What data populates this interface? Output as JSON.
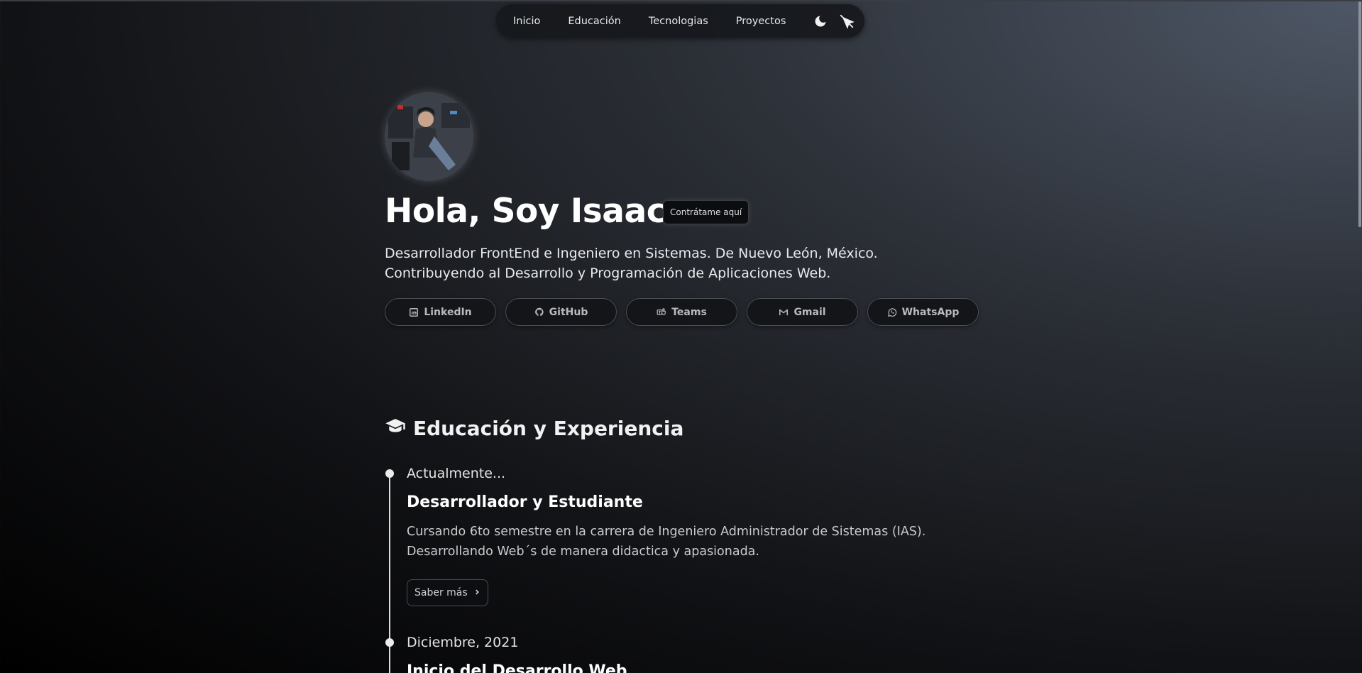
{
  "nav": {
    "items": [
      "Inicio",
      "Educación",
      "Tecnologias",
      "Proyectos"
    ],
    "theme_icon": "moon-icon",
    "extra_icon": "no-pointer-icon"
  },
  "hero": {
    "avatar": "profile-photo",
    "title": "Hola, Soy Isaac",
    "hire_label": "Contrátame aquí",
    "description": "Desarrollador FrontEnd e Ingeniero en Sistemas. De Nuevo León, México. Contribuyendo al Desarrollo y Programación de Aplicaciones Web.",
    "socials": [
      {
        "label": "LinkedIn",
        "icon": "linkedin-icon"
      },
      {
        "label": "GitHub",
        "icon": "github-icon"
      },
      {
        "label": "Teams",
        "icon": "teams-icon"
      },
      {
        "label": "Gmail",
        "icon": "gmail-icon"
      },
      {
        "label": "WhatsApp",
        "icon": "whatsapp-icon"
      }
    ]
  },
  "education": {
    "title": "Educación y Experiencia",
    "icon": "graduation-cap-icon",
    "items": [
      {
        "date": "Actualmente...",
        "title": "Desarrollador y Estudiante",
        "description": "Cursando 6to semestre en la carrera de Ingeniero Administrador de Sistemas (IAS). Desarrollando Web´s de manera didactica y apasionada.",
        "more_label": "Saber más"
      },
      {
        "date": "Diciembre, 2021",
        "title": "Inicio del Desarrollo Web"
      }
    ]
  }
}
